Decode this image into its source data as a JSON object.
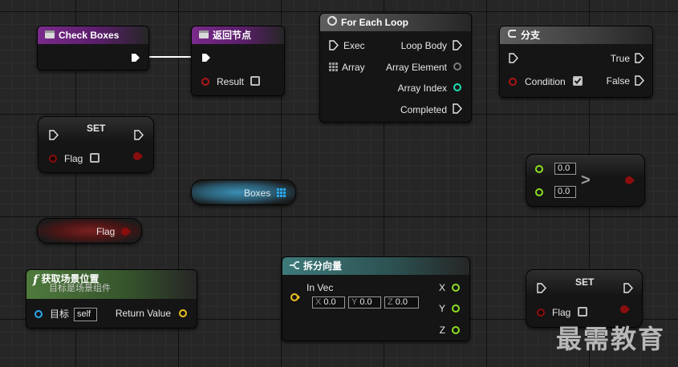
{
  "nodes": {
    "check_boxes": {
      "title": "Check Boxes"
    },
    "return_node": {
      "title": "返回节点",
      "result_label": "Result",
      "result_value": false
    },
    "for_each_loop": {
      "title": "For Each Loop",
      "exec_label": "Exec",
      "array_label": "Array",
      "loop_body_label": "Loop Body",
      "array_element_label": "Array Element",
      "array_index_label": "Array Index",
      "completed_label": "Completed"
    },
    "branch": {
      "title": "分支",
      "condition_label": "Condition",
      "condition_value": true,
      "true_label": "True",
      "false_label": "False"
    },
    "set_flag_1": {
      "title": "SET",
      "flag_label": "Flag",
      "flag_value": false
    },
    "boxes_var": {
      "label": "Boxes"
    },
    "flag_var": {
      "label": "Flag"
    },
    "greater": {
      "a": "0.0",
      "b": "0.0",
      "operator": ">"
    },
    "get_location": {
      "title": "获取场景位置",
      "subtitle": "目标是场景组件",
      "target_label": "目标",
      "target_value": "self",
      "return_label": "Return Value"
    },
    "break_vector": {
      "title": "拆分向量",
      "in_label": "In Vec",
      "x_axis": "X",
      "x_value": "0.0",
      "y_axis": "Y",
      "y_value": "0.0",
      "z_axis": "Z",
      "z_value": "0.0",
      "out_x": "X",
      "out_y": "Y",
      "out_z": "Z"
    },
    "set_flag_2": {
      "title": "SET",
      "flag_label": "Flag",
      "flag_value": false
    }
  },
  "watermark": "最需教育",
  "colors": {
    "exec_pin": "#ffffff",
    "bool_pin": "#8a0e0e",
    "int_pin": "#1fe0b0",
    "vector_pin": "#f0c020",
    "object_pin": "#2aa8f0",
    "wildcard_pin": "#7a7a7a"
  },
  "icons": [
    "function-entry-icon",
    "function-return-icon",
    "loop-icon",
    "branch-icon",
    "function-icon",
    "break-vector-icon",
    "array-icon"
  ]
}
